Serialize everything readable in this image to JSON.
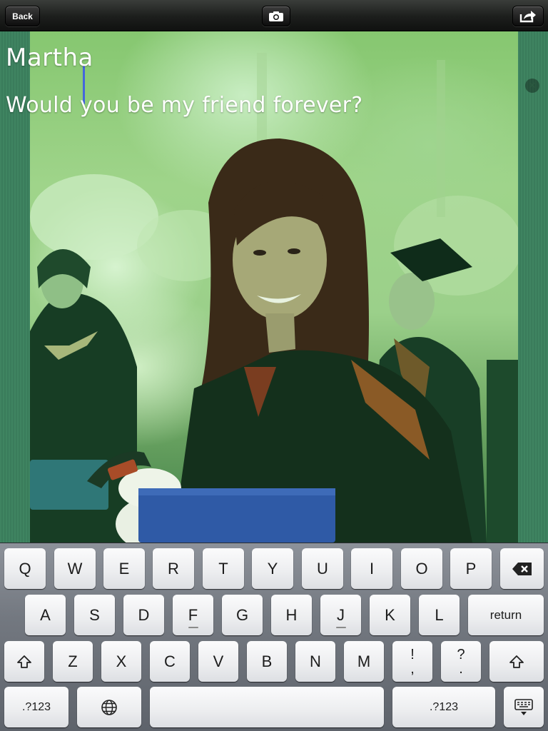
{
  "toolbar": {
    "back_label": "Back",
    "camera_icon": "camera-icon",
    "share_icon": "share-icon"
  },
  "card": {
    "name_value": "Martha",
    "message_value": "Would you be my friend forever?",
    "clear_icon": "clear-icon"
  },
  "keyboard": {
    "row1": [
      "Q",
      "W",
      "E",
      "R",
      "T",
      "Y",
      "U",
      "I",
      "O",
      "P"
    ],
    "row2": [
      "A",
      "S",
      "D",
      "F",
      "G",
      "H",
      "J",
      "K",
      "L"
    ],
    "row3": [
      "Z",
      "X",
      "C",
      "V",
      "B",
      "N",
      "M"
    ],
    "return_label": "return",
    "numbers_label": ".?123",
    "punct_exclaim": "!",
    "punct_comma": ",",
    "punct_question": "?",
    "punct_period": ".",
    "icons": [
      "delete-icon",
      "shift-icon",
      "globe-icon",
      "hide-keyboard-icon"
    ]
  },
  "colors": {
    "toolbar": "#1c1e1c",
    "overlay_green": "#3b7e5c",
    "cursor": "#4466dd"
  }
}
